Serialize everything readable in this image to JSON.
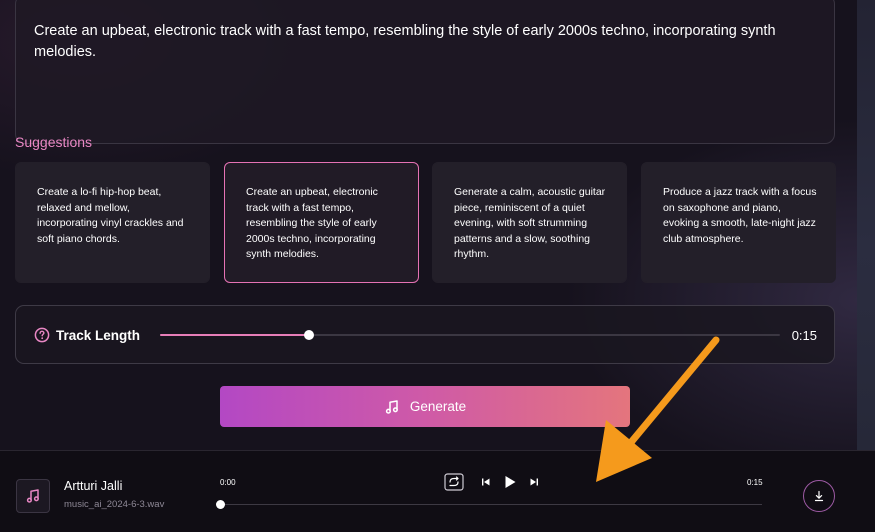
{
  "prompt": {
    "text": "Create an upbeat, electronic track with a fast tempo, resembling the style of early 2000s techno, incorporating synth melodies."
  },
  "suggestions": {
    "title": "Suggestions",
    "items": [
      {
        "text": "Create a lo-fi hip-hop beat, relaxed and mellow, incorporating vinyl crackles and soft piano chords.",
        "selected": false
      },
      {
        "text": "Create an upbeat, electronic track with a fast tempo, resembling the style of early 2000s techno, incorporating synth melodies.",
        "selected": true
      },
      {
        "text": "Generate a calm, acoustic guitar piece, reminiscent of a quiet evening, with soft strumming patterns and a slow, soothing rhythm.",
        "selected": false
      },
      {
        "text": "Produce a jazz track with a focus on saxophone and piano, evoking a smooth, late-night jazz club atmosphere.",
        "selected": false
      }
    ]
  },
  "track_length": {
    "label": "Track Length",
    "value_text": "0:15",
    "slider_fraction": 0.24,
    "help_icon": "question-circle-icon"
  },
  "generate": {
    "label": "Generate",
    "icon": "music-note-icon"
  },
  "player": {
    "artist": "Artturi Jalli",
    "filename": "music_ai_2024-6-3.wav",
    "time_current": "0:00",
    "time_total": "0:15",
    "progress_fraction": 0.0,
    "icons": [
      "music-note-icon",
      "loop-icon",
      "skip-back-icon",
      "play-icon",
      "skip-forward-icon",
      "download-icon"
    ]
  },
  "colors": {
    "accent_pink": "#e987c4",
    "arrow_orange": "#f59a1c",
    "button_gradient_start": "#b348c4",
    "button_gradient_end": "#e4757d"
  }
}
